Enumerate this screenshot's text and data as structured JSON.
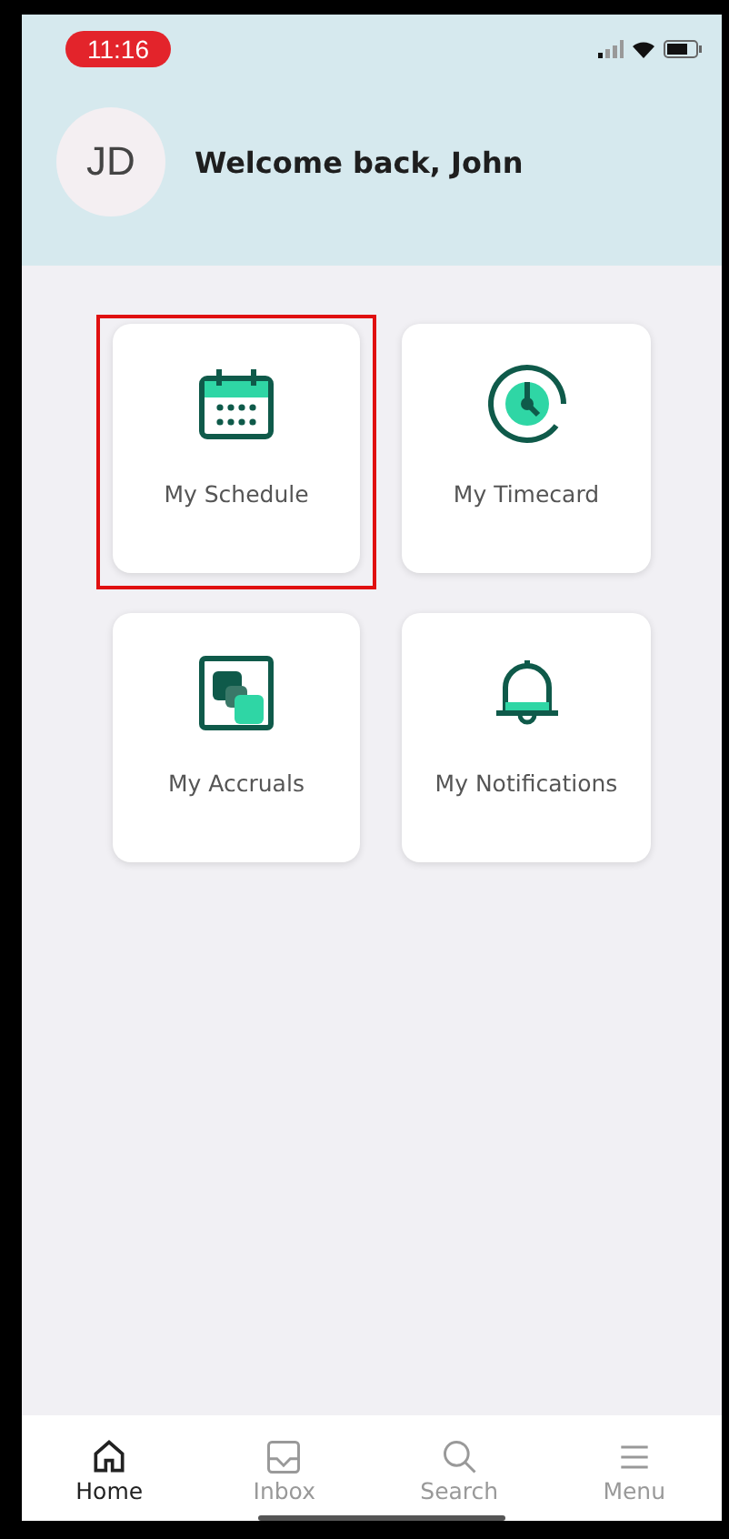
{
  "status_bar": {
    "time": "11:16"
  },
  "header": {
    "initials": "JD",
    "greeting": "Welcome back, John"
  },
  "tiles": [
    {
      "kind": "calendar",
      "label": "My Schedule",
      "highlighted": true
    },
    {
      "kind": "clock",
      "label": "My Timecard",
      "highlighted": false
    },
    {
      "kind": "accruals",
      "label": "My Accruals",
      "highlighted": false
    },
    {
      "kind": "bell",
      "label": "My Notifications",
      "highlighted": false
    }
  ],
  "nav": [
    {
      "kind": "home",
      "label": "Home",
      "selected": true
    },
    {
      "kind": "inbox",
      "label": "Inbox",
      "selected": false
    },
    {
      "kind": "search",
      "label": "Search",
      "selected": false
    },
    {
      "kind": "menu",
      "label": "Menu",
      "selected": false
    }
  ]
}
